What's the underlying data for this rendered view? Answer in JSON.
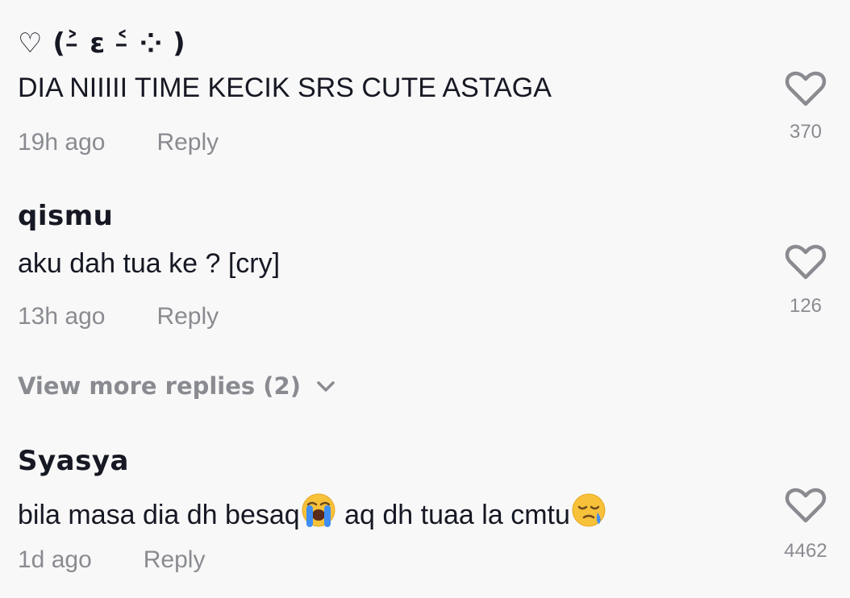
{
  "comments": [
    {
      "username": "♡ (˃̵ ε ˂̵ ⁘ )",
      "text": "DIA NIIIII TIME KECIK SRS CUTE ASTAGA",
      "time": "19h ago",
      "reply": "Reply",
      "likes": "370"
    },
    {
      "username": "qismu",
      "text": "aku dah tua ke ? [cry]",
      "time": "13h ago",
      "reply": "Reply",
      "likes": "126"
    },
    {
      "username": "Syasya",
      "text_part1": "bila masa dia dh besaq",
      "emoji1": "loudly-crying-face",
      "text_part2": " aq dh tuaa la cmtu",
      "emoji2": "sleepy-face",
      "time": "1d ago",
      "reply": "Reply",
      "likes": "4462"
    }
  ],
  "view_more": "View more replies (2)",
  "colors": {
    "background": "#f8f8f8",
    "primary_text": "#161823",
    "secondary_text": "#8a8b91"
  }
}
